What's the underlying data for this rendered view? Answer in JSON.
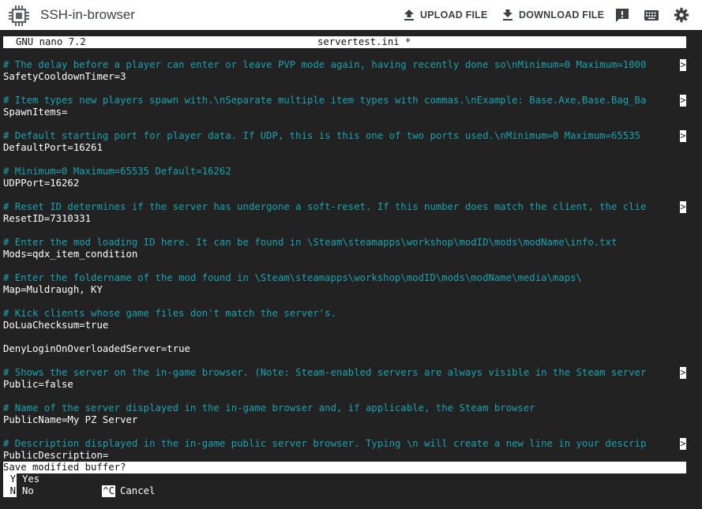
{
  "app": {
    "title": "SSH-in-browser",
    "upload_label": "UPLOAD FILE",
    "download_label": "DOWNLOAD FILE",
    "icons": [
      "chip-icon",
      "upload-icon",
      "download-icon",
      "feedback-icon",
      "keyboard-icon",
      "gear-icon"
    ]
  },
  "nano": {
    "version": "GNU nano 7.2",
    "filename": "servertest.ini *",
    "truncation_marker": ">",
    "lines": [
      "# The delay before a player can enter or leave PVP mode again, having recently done so\\nMinimum=0 Maximum=1000",
      "SafetyCooldownTimer=3",
      "",
      "# Item types new players spawn with.\\nSeparate multiple item types with commas.\\nExample: Base.Axe,Base.Bag_Ba",
      "SpawnItems=",
      "",
      "# Default starting port for player data. If UDP, this is this one of two ports used.\\nMinimum=0 Maximum=65535 ",
      "DefaultPort=16261",
      "",
      "# Minimum=0 Maximum=65535 Default=16262",
      "UDPPort=16262",
      "",
      "# Reset ID determines if the server has undergone a soft-reset. If this number does match the client, the clie",
      "ResetID=7310331",
      "",
      "# Enter the mod loading ID here. It can be found in \\Steam\\steamapps\\workshop\\modID\\mods\\modName\\info.txt",
      "Mods=qdx_item_condition",
      "",
      "# Enter the foldername of the mod found in \\Steam\\steamapps\\workshop\\modID\\mods\\modName\\media\\maps\\",
      "Map=Muldraugh, KY",
      "",
      "# Kick clients whose game files don't match the server's.",
      "DoLuaChecksum=true",
      "",
      "DenyLoginOnOverloadedServer=true",
      "",
      "# Shows the server on the in-game browser. (Note: Steam-enabled servers are always visible in the Steam server",
      "Public=false",
      "",
      "# Name of the server displayed in the in-game browser and, if applicable, the Steam browser",
      "PublicName=My PZ Server",
      "",
      "# Description displayed in the in-game public server browser. Typing \\n will create a new line in your descrip",
      "PublicDescription="
    ],
    "truncated_lines": [
      0,
      3,
      6,
      12,
      26,
      32
    ],
    "prompt": "Save modified buffer?",
    "options": [
      {
        "key": "Y",
        "label": "Yes"
      },
      {
        "key": "N",
        "label": "No"
      },
      {
        "key": "^C",
        "label": "Cancel"
      }
    ],
    "colors": {
      "background": "#222222",
      "comment": "#1aa3b0",
      "text": "#ffffff",
      "bar": "#ffffff"
    }
  }
}
